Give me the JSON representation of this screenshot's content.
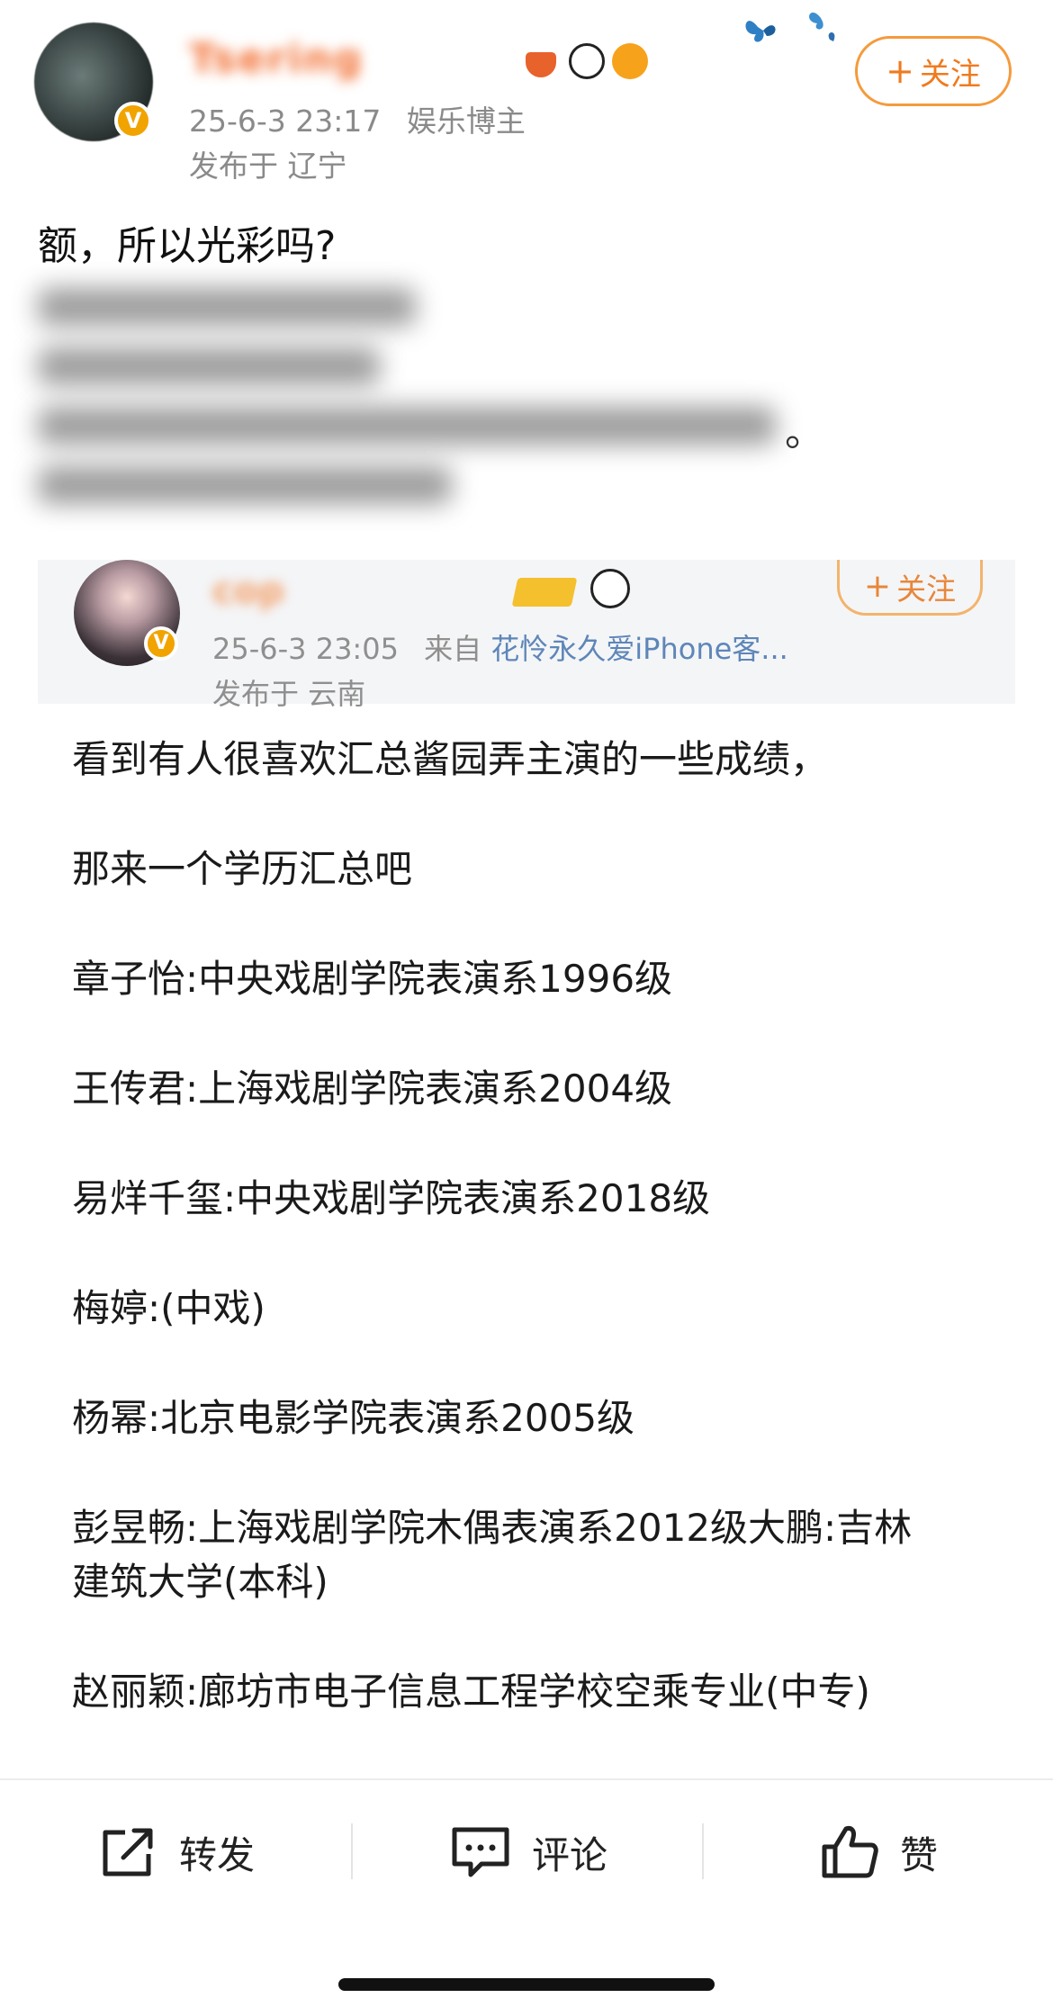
{
  "post": {
    "username": "Tsering",
    "timestamp": "25-6-3 23:17",
    "category": "娱乐博主",
    "location": "发布于 辽宁",
    "follow_label": "关注",
    "follow_plus": "+",
    "text_first_line": "额，所以光彩吗?",
    "text_trailing_punct": "。"
  },
  "quoted": {
    "username": "cop",
    "timestamp": "25-6-3 23:05",
    "from_prefix": "来自",
    "source": "花怜永久爱iPhone客...",
    "location": "发布于 云南",
    "follow_label": "关注",
    "follow_plus": "+",
    "lines": [
      "看到有人很喜欢汇总酱园弄主演的一些成绩，",
      "那来一个学历汇总吧",
      "章子怡:中央戏剧学院表演系1996级",
      "王传君:上海戏剧学院表演系2004级",
      "易烊千玺:中央戏剧学院表演系2018级",
      "梅婷:(中戏)",
      "杨幂:北京电影学院表演系2005级",
      "彭昱畅:上海戏剧学院木偶表演系2012级大鹏:吉林",
      "建筑大学(本科)",
      "赵丽颖:廊坊市电子信息工程学校空乘专业(中专)"
    ]
  },
  "actions": {
    "repost": "转发",
    "comment": "评论",
    "like": "赞"
  },
  "colors": {
    "accent_orange": "#f07a1e",
    "meta_gray": "#8a8a8a",
    "link_blue": "#5e86b8",
    "verified_gold": "#f1a300"
  },
  "icons": [
    "verified-badge-icon",
    "repost-icon",
    "comment-icon",
    "like-icon",
    "butterfly-icon",
    "panda-icon"
  ]
}
